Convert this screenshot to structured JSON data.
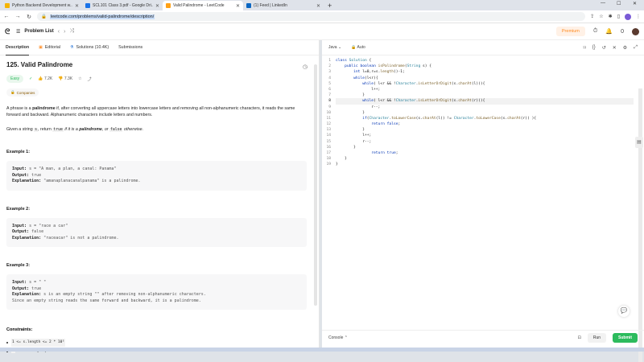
{
  "browser": {
    "tabs": [
      {
        "title": "Python Backend Development w...",
        "color": "#f5b400"
      },
      {
        "title": "SCL101 Class 3.pdf - Google Dri...",
        "color": "#1a73e8"
      },
      {
        "title": "Valid Palindrome - LeetCode",
        "color": "#ffa116"
      },
      {
        "title": "(1) Feed | LinkedIn",
        "color": "#0a66c2"
      }
    ],
    "new_tab": "+",
    "url": "leetcode.com/problems/valid-palindrome/description/"
  },
  "header": {
    "problem_list": "Problem List",
    "premium": "Premium",
    "notif_count": "0"
  },
  "left_tabs": [
    "Description",
    "Editorial",
    "Solutions (10.4K)",
    "Submissions"
  ],
  "problem": {
    "title": "125. Valid Palindrome",
    "difficulty": "Easy",
    "likes": "7.2K",
    "dislikes": "7.3K",
    "companies": "Companies",
    "desc_1a": "A phrase is a ",
    "desc_1b": "palindrome",
    "desc_1c": " if, after converting all uppercase letters into lowercase letters and removing all non-alphanumeric characters, it reads the same forward and backward. Alphanumeric characters include letters and numbers.",
    "desc_2a": "Given a string ",
    "desc_2b": "s",
    "desc_2c": ", return ",
    "desc_2d": "true",
    "desc_2e": " if it is a ",
    "desc_2f": "palindrome",
    "desc_2g": ", or ",
    "desc_2h": "false",
    "desc_2i": " otherwise.",
    "examples": [
      {
        "h": "Example 1:",
        "input": "s = \"A man, a plan, a canal: Panama\"",
        "output": "true",
        "expl": "\"amanaplanacanalpanama\" is a palindrome.",
        "expl2": ""
      },
      {
        "h": "Example 2:",
        "input": "s = \"race a car\"",
        "output": "false",
        "expl": "\"raceacar\" is not a palindrome.",
        "expl2": ""
      },
      {
        "h": "Example 3:",
        "input": "s = \" \"",
        "output": "true",
        "expl": "s is an empty string \"\" after removing non-alphanumeric characters.",
        "expl2": "Since an empty string reads the same forward and backward, it is a palindrome."
      }
    ],
    "input_label": "Input:",
    "output_label": "Output:",
    "expl_label": "Explanation:",
    "constraints_title": "Constraints:",
    "constraints": [
      "1 <= s.length <= 2 * 10⁵",
      "s",
      " consists only of printable ASCII characters."
    ]
  },
  "editor": {
    "language": "Java",
    "auto": "Auto",
    "lines": [
      {
        "n": "1",
        "t": "class Solution {"
      },
      {
        "n": "2",
        "t": "    public boolean isPalindrome(String s) {"
      },
      {
        "n": "3",
        "t": "        int l=0,r=s.length()-1;"
      },
      {
        "n": "4",
        "t": "        while(l<r){"
      },
      {
        "n": "5",
        "t": "            while( l<r && !Character.isLetterOrDigit(s.charAt(l))){"
      },
      {
        "n": "6",
        "t": "                l++;"
      },
      {
        "n": "7",
        "t": "            }"
      },
      {
        "n": "8",
        "t": "            while( l<r && !Character.isLetterOrDigit(s.charAt(r))){"
      },
      {
        "n": "9",
        "t": "                r--;"
      },
      {
        "n": "10",
        "t": "            }"
      },
      {
        "n": "11",
        "t": "            if(Character.toLowerCase(s.charAt(l)) != Character.toLowerCase(s.charAt(r)) ){"
      },
      {
        "n": "12",
        "t": "                return false;"
      },
      {
        "n": "13",
        "t": "            }"
      },
      {
        "n": "14",
        "t": "            l++;"
      },
      {
        "n": "15",
        "t": "            r--;"
      },
      {
        "n": "16",
        "t": "        }"
      },
      {
        "n": "17",
        "t": "                return true;"
      },
      {
        "n": "18",
        "t": "    }"
      },
      {
        "n": "19",
        "t": "}"
      }
    ],
    "console": "Console",
    "run": "Run",
    "submit": "Submit"
  }
}
